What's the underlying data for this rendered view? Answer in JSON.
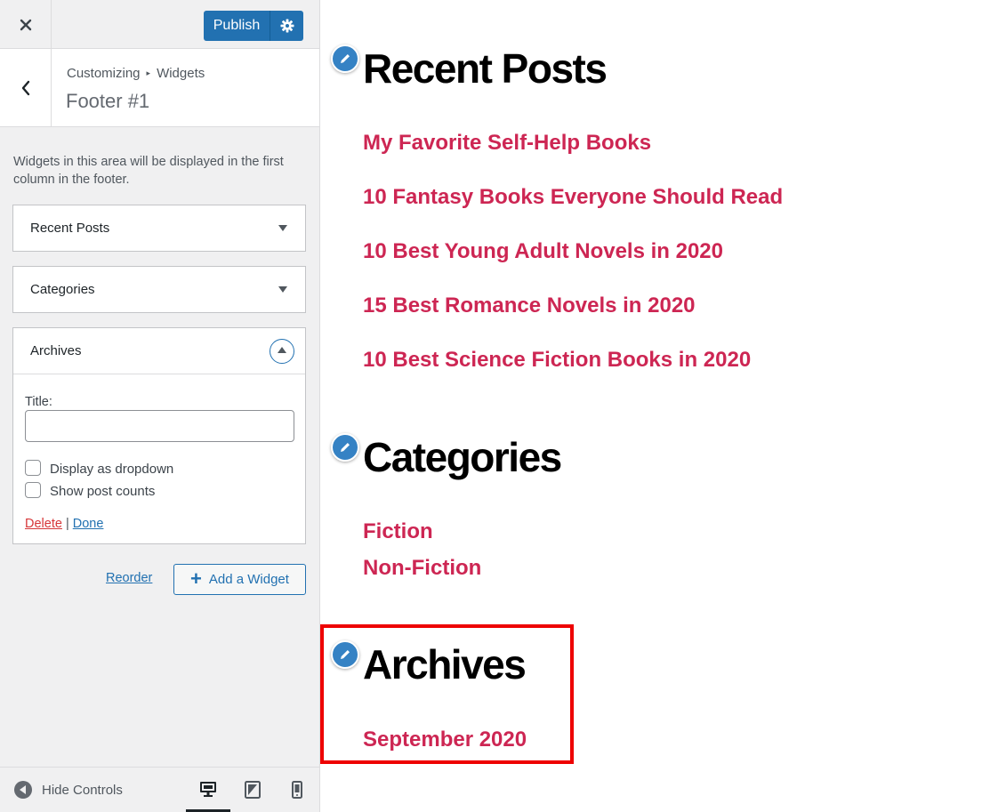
{
  "topbar": {
    "close_label": "×",
    "publish_label": "Publish"
  },
  "section": {
    "breadcrumb_root": "Customizing",
    "breadcrumb_separator": "▸",
    "breadcrumb_current": "Widgets",
    "title": "Footer #1"
  },
  "description": "Widgets in this area will be displayed in the first column in the footer.",
  "widgets": [
    {
      "title": "Recent Posts",
      "expanded": false
    },
    {
      "title": "Categories",
      "expanded": false
    },
    {
      "title": "Archives",
      "expanded": true
    }
  ],
  "archives_form": {
    "title_label": "Title:",
    "title_value": "",
    "dropdown_label": "Display as dropdown",
    "dropdown_checked": false,
    "counts_label": "Show post counts",
    "counts_checked": false,
    "delete_label": "Delete",
    "separator": "|",
    "done_label": "Done"
  },
  "actions": {
    "reorder_label": "Reorder",
    "add_widget_label": "Add a Widget"
  },
  "footer": {
    "hide_controls_label": "Hide Controls",
    "devices": [
      "desktop",
      "tablet",
      "mobile"
    ],
    "active_device": "desktop"
  },
  "preview": {
    "recent_posts": {
      "heading": "Recent Posts",
      "items": [
        "My Favorite Self-Help Books",
        "10 Fantasy Books Everyone Should Read",
        "10 Best Young Adult Novels in 2020",
        "15 Best Romance Novels in 2020",
        "10 Best Science Fiction Books in 2020"
      ]
    },
    "categories": {
      "heading": "Categories",
      "items": [
        "Fiction",
        "Non-Fiction"
      ]
    },
    "archives": {
      "heading": "Archives",
      "items": [
        "September 2020"
      ]
    }
  },
  "colors": {
    "accent": "#2271b1",
    "link": "#cd2653",
    "highlight": "#ee0000",
    "panel": "#f0f0f1"
  }
}
